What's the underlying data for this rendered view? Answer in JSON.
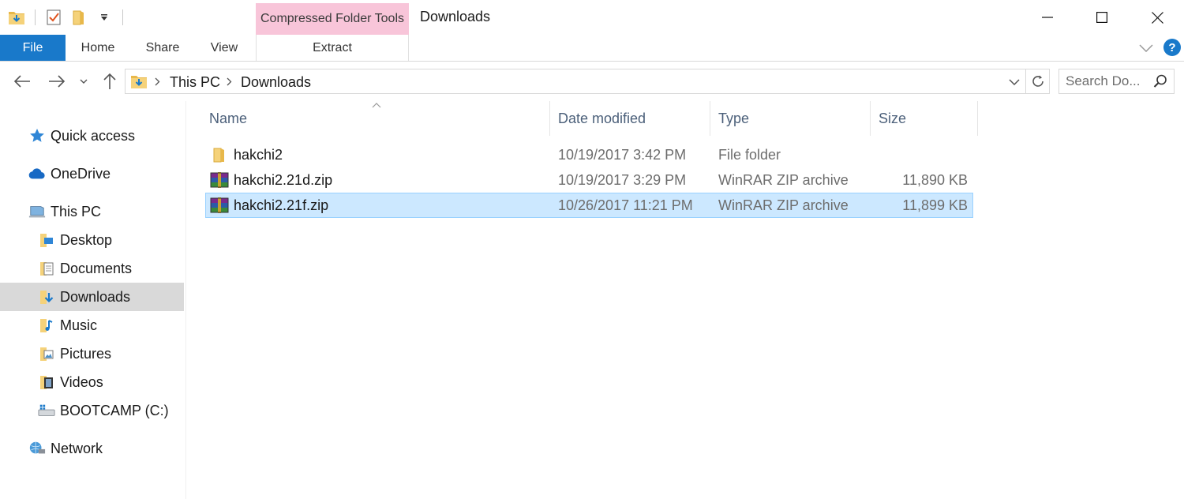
{
  "window": {
    "title": "Downloads",
    "contextual_tab_group": "Compressed Folder Tools"
  },
  "ribbon": {
    "tabs": [
      {
        "label": "File"
      },
      {
        "label": "Home"
      },
      {
        "label": "Share"
      },
      {
        "label": "View"
      },
      {
        "label": "Extract"
      }
    ],
    "help_label": "?"
  },
  "address": {
    "crumbs": [
      "This PC",
      "Downloads"
    ]
  },
  "search": {
    "placeholder": "Search Do..."
  },
  "sidebar": {
    "items": [
      {
        "label": "Quick access",
        "icon": "star-icon"
      },
      {
        "label": "OneDrive",
        "icon": "cloud-icon"
      },
      {
        "label": "This PC",
        "icon": "computer-icon"
      },
      {
        "label": "Desktop",
        "icon": "desktop-folder-icon"
      },
      {
        "label": "Documents",
        "icon": "documents-folder-icon"
      },
      {
        "label": "Downloads",
        "icon": "downloads-folder-icon",
        "selected": true
      },
      {
        "label": "Music",
        "icon": "music-folder-icon"
      },
      {
        "label": "Pictures",
        "icon": "pictures-folder-icon"
      },
      {
        "label": "Videos",
        "icon": "videos-folder-icon"
      },
      {
        "label": "BOOTCAMP (C:)",
        "icon": "drive-icon"
      },
      {
        "label": "Network",
        "icon": "network-icon"
      }
    ]
  },
  "filelist": {
    "columns": [
      "Name",
      "Date modified",
      "Type",
      "Size"
    ],
    "rows": [
      {
        "name": "hakchi2",
        "date": "10/19/2017 3:42 PM",
        "type": "File folder",
        "size": "",
        "icon": "folder-icon"
      },
      {
        "name": "hakchi2.21d.zip",
        "date": "10/19/2017 3:29 PM",
        "type": "WinRAR ZIP archive",
        "size": "11,890 KB",
        "icon": "winrar-archive-icon"
      },
      {
        "name": "hakchi2.21f.zip",
        "date": "10/26/2017 11:21 PM",
        "type": "WinRAR ZIP archive",
        "size": "11,899 KB",
        "icon": "winrar-archive-icon",
        "selected": true
      }
    ]
  },
  "colors": {
    "accent": "#1979ca",
    "context_tab": "#f8c5d9",
    "selection_bg": "#cce8ff",
    "selection_border": "#99d1ff",
    "sidebar_selected": "#d9d9d9"
  }
}
